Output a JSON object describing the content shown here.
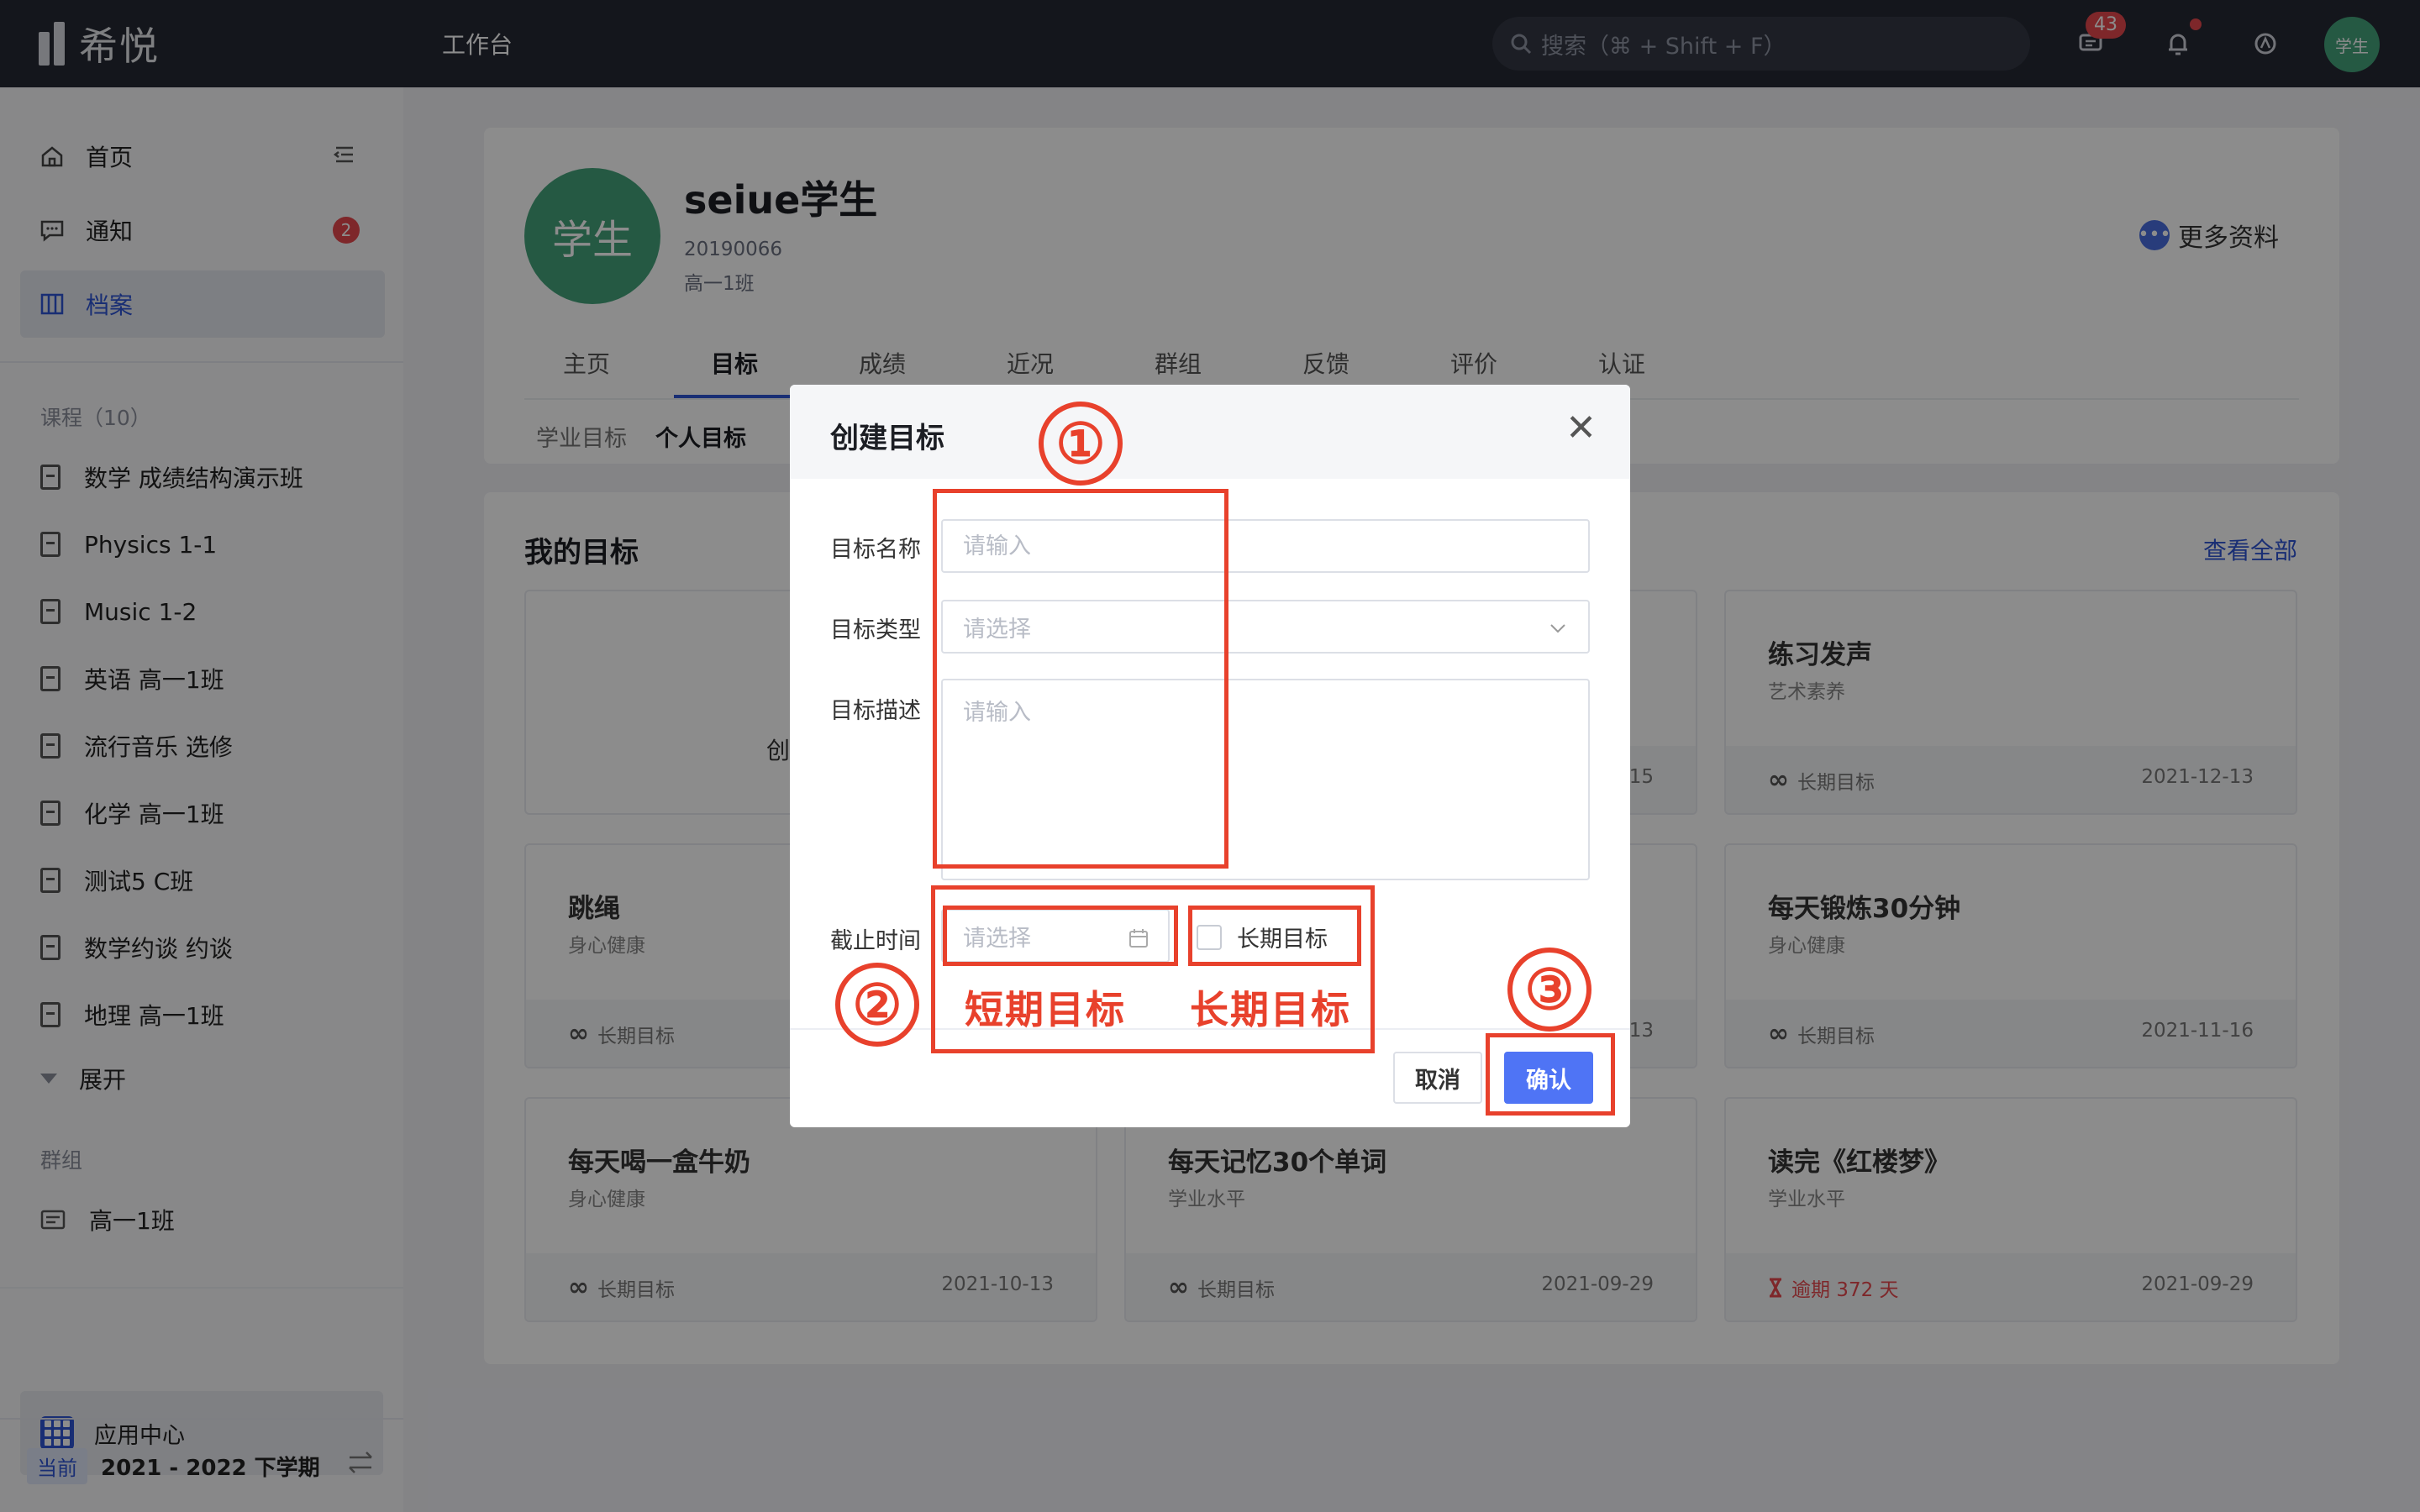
{
  "topbar": {
    "logo_text": "希悦",
    "workbench": "工作台",
    "search_placeholder": "搜索（⌘ + Shift + F）",
    "message_count": "43",
    "avatar_label": "学生"
  },
  "sidebar": {
    "nav": [
      {
        "label": "首页"
      },
      {
        "label": "通知",
        "badge": "2"
      },
      {
        "label": "档案"
      }
    ],
    "courses_section": "课程（10）",
    "courses": [
      "数学 成绩结构演示班",
      "Physics 1-1",
      "Music 1-2",
      "英语 高一1班",
      "流行音乐 选修",
      "化学 高一1班",
      "测试5 C班",
      "数学约谈 约谈",
      "地理 高一1班"
    ],
    "expand": "展开",
    "groups_section": "群组",
    "groups": [
      "高一1班"
    ],
    "app_center": "应用中心",
    "term_tag": "当前",
    "term": "2021 - 2022 下学期"
  },
  "profile": {
    "avatar_label": "学生",
    "name": "seiue学生",
    "student_id": "20190066",
    "class": "高一1班",
    "more_info": "更多资料",
    "tabs": [
      "主页",
      "目标",
      "成绩",
      "近况",
      "群组",
      "反馈",
      "评价",
      "认证"
    ],
    "active_tab": "目标",
    "subtabs": [
      "学业目标",
      "个人目标"
    ],
    "active_subtab": "个人目标"
  },
  "goals": {
    "title": "我的目标",
    "view_all": "查看全部",
    "create_hint": "创",
    "items": [
      {
        "name": "练习发声",
        "category": "艺术素养",
        "type": "长期目标",
        "date": "2021-12-13"
      },
      {
        "name": "跳绳",
        "category": "身心健康",
        "type": "长期目标",
        "date": ""
      },
      {
        "name": "每天锻炼30分钟",
        "category": "身心健康",
        "type": "长期目标",
        "date": "2021-11-16"
      },
      {
        "name": "每天喝一盒牛奶",
        "category": "身心健康",
        "type": "长期目标",
        "date": "2021-10-13"
      },
      {
        "name": "每天记忆30个单词",
        "category": "学业水平",
        "type": "长期目标",
        "date": "2021-09-29"
      },
      {
        "name": "读完《红楼梦》",
        "category": "学业水平",
        "type": "逾期 372 天",
        "date": "2021-09-29"
      }
    ],
    "peek_dates": [
      "15",
      "13"
    ]
  },
  "modal": {
    "title": "创建目标",
    "fields": {
      "name_label": "目标名称",
      "name_placeholder": "请输入",
      "type_label": "目标类型",
      "type_placeholder": "请选择",
      "desc_label": "目标描述",
      "desc_placeholder": "请输入",
      "deadline_label": "截止时间",
      "deadline_placeholder": "请选择",
      "long_term_label": "长期目标"
    },
    "cancel": "取消",
    "confirm": "确认"
  },
  "annotations": {
    "num1": "①",
    "num2": "②",
    "num3": "③",
    "short_term": "短期目标",
    "long_term": "长期目标"
  },
  "colors": {
    "accent": "#2f55d4",
    "confirm": "#4f74f5",
    "annotation": "#e8412c",
    "avatar": "#44a37b",
    "topbar": "#252833"
  }
}
